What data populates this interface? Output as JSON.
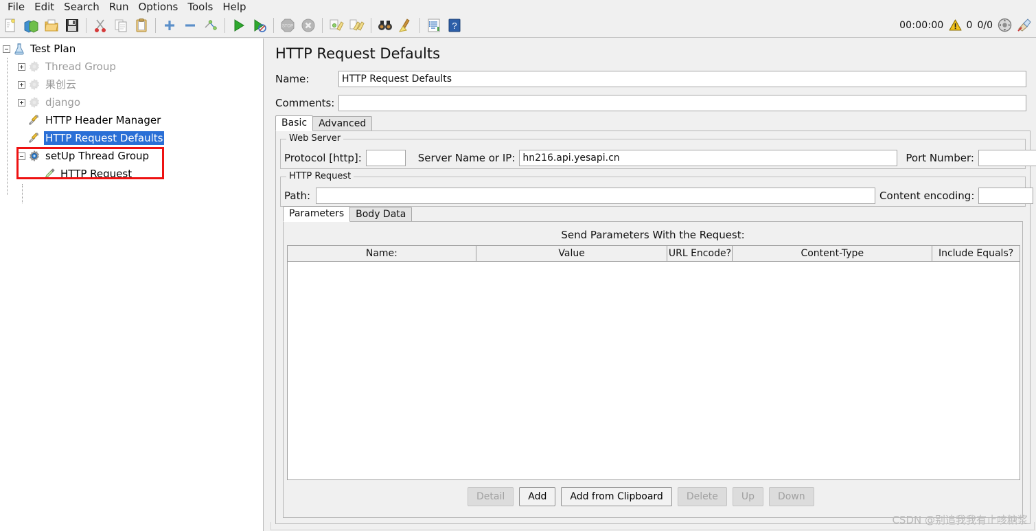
{
  "menu": {
    "items": [
      "File",
      "Edit",
      "Search",
      "Run",
      "Options",
      "Tools",
      "Help"
    ]
  },
  "toolbar": {
    "icons": [
      {
        "name": "new-icon",
        "glyph": "new"
      },
      {
        "name": "templates-icon",
        "glyph": "templates"
      },
      {
        "name": "open-icon",
        "glyph": "open"
      },
      {
        "name": "save-icon",
        "glyph": "save"
      },
      {
        "name": "cut-icon",
        "glyph": "cut"
      },
      {
        "name": "copy-icon",
        "glyph": "copy"
      },
      {
        "name": "paste-icon",
        "glyph": "paste"
      },
      {
        "name": "expand-all-icon",
        "glyph": "plus"
      },
      {
        "name": "collapse-all-icon",
        "glyph": "minus"
      },
      {
        "name": "toggle-icon",
        "glyph": "toggle"
      },
      {
        "name": "start-icon",
        "glyph": "start"
      },
      {
        "name": "start-no-pauses-icon",
        "glyph": "start-nopause"
      },
      {
        "name": "stop-icon",
        "glyph": "stop"
      },
      {
        "name": "shutdown-icon",
        "glyph": "shutdown"
      },
      {
        "name": "clear-icon",
        "glyph": "clear"
      },
      {
        "name": "clear-all-icon",
        "glyph": "clear-all"
      },
      {
        "name": "search-icon",
        "glyph": "binoculars"
      },
      {
        "name": "reset-search-icon",
        "glyph": "broom"
      },
      {
        "name": "function-helper-icon",
        "glyph": "list"
      },
      {
        "name": "help-icon",
        "glyph": "help"
      }
    ],
    "timer": "00:00:00",
    "warning_count": "0",
    "thread_counter": "0/0",
    "warning_color": "#f2c21a"
  },
  "tree": {
    "nodes": [
      {
        "label": "Test Plan",
        "icon": "test-plan-icon",
        "indent": 0,
        "handle": "minus",
        "state": "normal"
      },
      {
        "label": "Thread Group",
        "icon": "thread-group-icon",
        "indent": 1,
        "handle": "plus",
        "state": "disabled"
      },
      {
        "label": "果创云",
        "icon": "thread-group-icon",
        "indent": 1,
        "handle": "plus",
        "state": "disabled"
      },
      {
        "label": "django",
        "icon": "thread-group-icon",
        "indent": 1,
        "handle": "plus",
        "state": "disabled"
      },
      {
        "label": "HTTP Header Manager",
        "icon": "config-element-icon",
        "indent": 1,
        "handle": "none",
        "state": "normal"
      },
      {
        "label": "HTTP Request Defaults",
        "icon": "config-element-icon",
        "indent": 1,
        "handle": "none",
        "state": "selected"
      },
      {
        "label": "setUp Thread Group",
        "icon": "setup-thread-group-icon",
        "indent": 1,
        "handle": "minus",
        "state": "normal"
      },
      {
        "label": "HTTP Request",
        "icon": "http-request-icon",
        "indent": 2,
        "handle": "none",
        "state": "normal"
      }
    ],
    "highlight_color": "#ee1111",
    "selection_color": "#2a6fd6"
  },
  "panel": {
    "title": "HTTP Request Defaults",
    "name_label": "Name:",
    "name_value": "HTTP Request Defaults",
    "comments_label": "Comments:",
    "comments_value": "",
    "tabs": [
      {
        "label": "Basic",
        "active": true
      },
      {
        "label": "Advanced",
        "active": false
      }
    ],
    "web_server": {
      "group_title": "Web Server",
      "protocol_label": "Protocol [http]:",
      "protocol_value": "",
      "server_label": "Server Name or IP:",
      "server_value": "hn216.api.yesapi.cn",
      "port_label": "Port Number:",
      "port_value": ""
    },
    "http_request": {
      "group_title": "HTTP Request",
      "path_label": "Path:",
      "path_value": "",
      "encoding_label": "Content encoding:",
      "encoding_value": ""
    },
    "inner_tabs": [
      {
        "label": "Parameters",
        "active": true
      },
      {
        "label": "Body Data",
        "active": false
      }
    ],
    "send_params_label": "Send Parameters With the Request:",
    "table": {
      "columns": [
        "Name:",
        "Value",
        "URL Encode?",
        "Content-Type",
        "Include Equals?"
      ],
      "rows": []
    },
    "buttons": [
      {
        "label": "Detail",
        "enabled": false
      },
      {
        "label": "Add",
        "enabled": true
      },
      {
        "label": "Add from Clipboard",
        "enabled": true
      },
      {
        "label": "Delete",
        "enabled": false
      },
      {
        "label": "Up",
        "enabled": false
      },
      {
        "label": "Down",
        "enabled": false
      }
    ]
  },
  "watermark": "CSDN @别追我我有止咳糖浆"
}
